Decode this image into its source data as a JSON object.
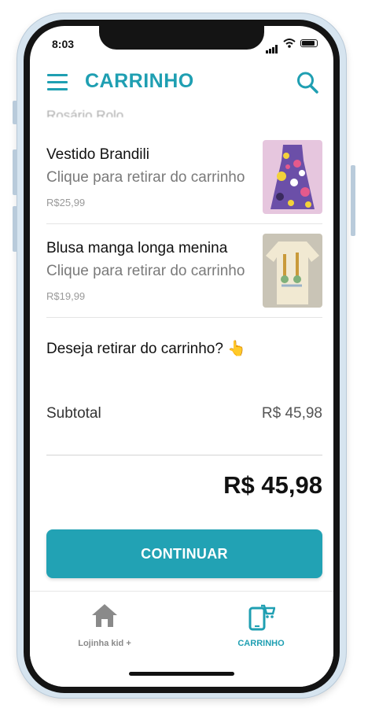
{
  "status_bar": {
    "time": "8:03"
  },
  "header": {
    "title": "CARRINHO"
  },
  "cut_off_text": "Rosário Rolo",
  "cart": {
    "items": [
      {
        "name": "Vestido Brandili",
        "hint": "Clique para retirar do carrinho",
        "price": "R$25,99",
        "thumb": "floral-dress-image"
      },
      {
        "name": "Blusa manga longa menina",
        "hint": "Clique para retirar do carrinho",
        "price": "R$19,99",
        "thumb": "cream-blouse-image"
      }
    ],
    "question": "Deseja retirar do carrinho? 👆",
    "subtotal_label": "Subtotal",
    "subtotal_value": "R$ 45,98",
    "total": "R$ 45,98",
    "continue_label": "CONTINUAR"
  },
  "tabbar": {
    "tabs": [
      {
        "label": "Lojinha kid +",
        "icon": "home-icon",
        "active": false
      },
      {
        "label": "CARRINHO",
        "icon": "mobile-cart-icon",
        "active": true
      }
    ]
  },
  "colors": {
    "accent": "#1f9fb2",
    "button": "#22a2b4",
    "inactive": "#8a8a8a"
  }
}
